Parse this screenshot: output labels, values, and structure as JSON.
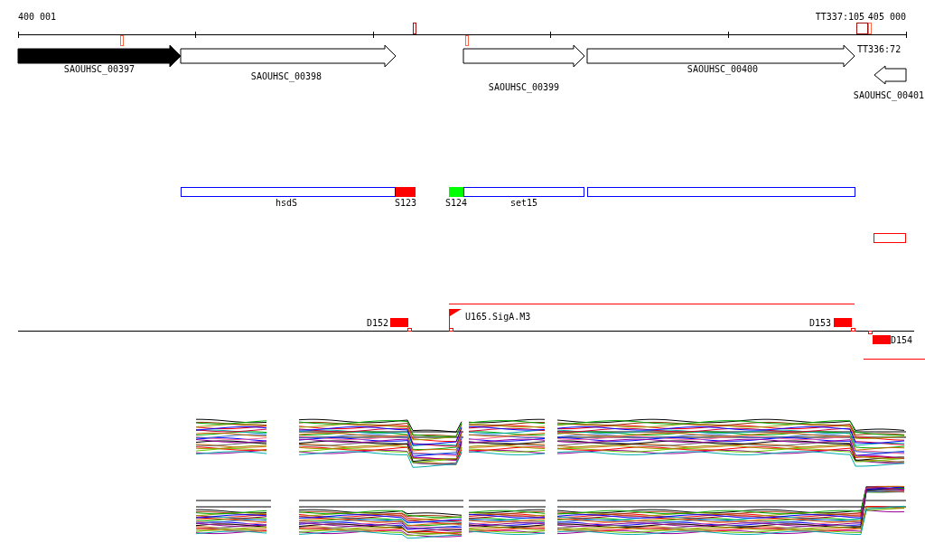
{
  "ruler": {
    "start_label": "400 001",
    "end_label": "405 000"
  },
  "terminators": [
    {
      "label": "TT337:105"
    },
    {
      "label": "TT336:72"
    }
  ],
  "genes": [
    {
      "label": "SAOUHSC_00397",
      "kind": "forward",
      "highlighted": true
    },
    {
      "label": "SAOUHSC_00398",
      "kind": "forward",
      "highlighted": false
    },
    {
      "label": "SAOUHSC_00399",
      "kind": "forward",
      "highlighted": false
    },
    {
      "label": "SAOUHSC_00400",
      "kind": "forward",
      "highlighted": false
    },
    {
      "label": "SAOUHSC_00401",
      "kind": "reverse",
      "highlighted": false
    }
  ],
  "features": [
    {
      "kind": "region",
      "label": "hsdS"
    },
    {
      "kind": "segment",
      "label": "S123",
      "color": "#ff0000"
    },
    {
      "kind": "segment",
      "label": "S124",
      "color": "#00ff00"
    },
    {
      "kind": "region",
      "label": "set15"
    },
    {
      "kind": "region"
    },
    {
      "kind": "marker"
    }
  ],
  "sites": [
    {
      "kind": "block",
      "label": "D152"
    },
    {
      "kind": "promoter",
      "label": "U165.SigA.M3"
    },
    {
      "kind": "block",
      "label": "D153"
    },
    {
      "kind": "block",
      "label": "D154"
    }
  ]
}
